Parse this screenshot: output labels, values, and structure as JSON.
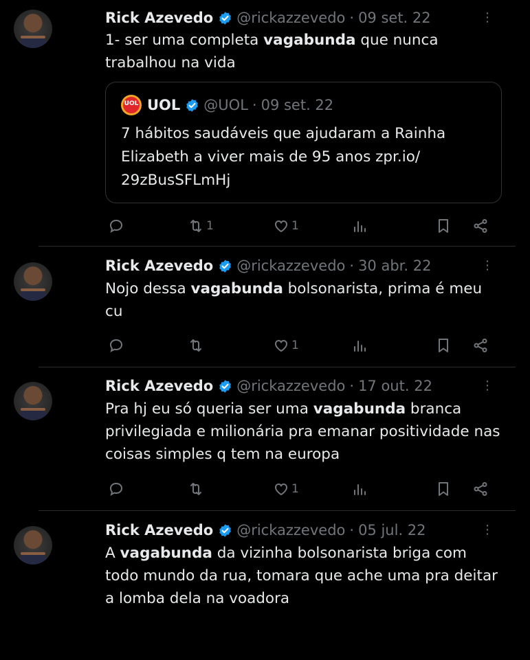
{
  "tweets": [
    {
      "name": "Rick Azevedo",
      "handle": "@rickazzevedo",
      "separator": "·",
      "date": "09 set. 22",
      "text_parts": [
        "1- ser uma completa ",
        "vagabunda",
        " que nunca trabalhou na vida"
      ],
      "quote": {
        "logo_text": "UOL",
        "name": "UOL",
        "handle": "@UOL",
        "separator": "·",
        "date": "09 set. 22",
        "text": "7 hábitos saudáveis que ajudaram a Rainha Elizabeth a viver mais de 95 anos zpr.io/ 29zBusSFLmHj"
      },
      "retweets": "1",
      "likes": "1"
    },
    {
      "name": "Rick Azevedo",
      "handle": "@rickazzevedo",
      "separator": "·",
      "date": "30 abr. 22",
      "text_parts": [
        "Nojo dessa ",
        "vagabunda",
        " bolsonarista, prima é meu cu"
      ],
      "retweets": "",
      "likes": "1"
    },
    {
      "name": "Rick Azevedo",
      "handle": "@rickazzevedo",
      "separator": "·",
      "date": "17 out. 22",
      "text_parts": [
        "Pra hj eu só queria ser uma ",
        "vagabunda",
        " branca privilegiada e milionária pra emanar positividade nas coisas simples q tem na europa"
      ],
      "retweets": "",
      "likes": "1"
    },
    {
      "name": "Rick Azevedo",
      "handle": "@rickazzevedo",
      "separator": "·",
      "date": "05 jul. 22",
      "text_parts": [
        "A ",
        "vagabunda",
        " da vizinha bolsonarista briga com todo mundo da rua, tomara que ache uma pra deitar a lomba dela na voadora"
      ]
    }
  ],
  "icons": {
    "reply": "reply-icon",
    "retweet": "retweet-icon",
    "like": "heart-icon",
    "views": "views-icon",
    "bookmark": "bookmark-icon",
    "share": "share-icon",
    "verified": "verified-badge-icon",
    "more": "more-options-icon"
  },
  "colors": {
    "background": "#000000",
    "text": "#e7e9ea",
    "muted": "#71767b",
    "verified": "#1d9bf0",
    "divider": "#2f3336"
  }
}
